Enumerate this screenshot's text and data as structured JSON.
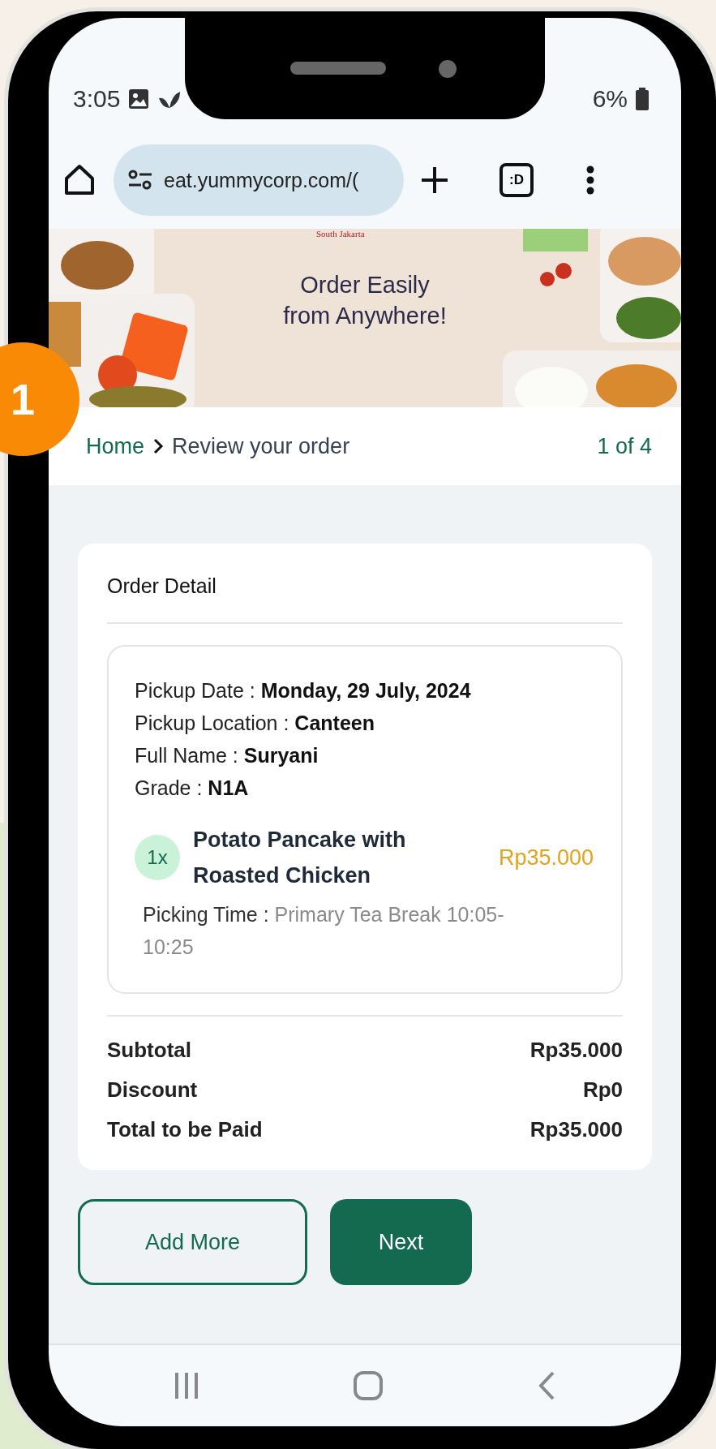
{
  "status_bar": {
    "time": "3:05",
    "battery": "6%"
  },
  "browser": {
    "url": "eat.yummycorp.com/(",
    "tabs": ":D"
  },
  "banner": {
    "brand": "South Jakarta",
    "headline": [
      "Order Easily",
      "from Anywhere!"
    ]
  },
  "step_badge": "1",
  "breadcrumb": {
    "home": "Home",
    "current": "Review your order",
    "step": "1 of 4"
  },
  "order": {
    "title": "Order Detail",
    "details": [
      "Pickup Date : **Monday, 29 July, 2024**",
      "Pickup Location : **Canteen**",
      "Full Name : **Suryani**",
      "Grade : **N1A**"
    ],
    "items": [
      {
        "quantity": "1x",
        "name": "Potato Pancake with Roasted Chicken",
        "price": "Rp35.000",
        "picking_label": "Picking Time :",
        "picking_value": "Primary Tea Break 10:05-10:25"
      }
    ],
    "totals": [
      {
        "label": "Subtotal",
        "value": "Rp35.000"
      },
      {
        "label": "Discount",
        "value": "Rp0"
      },
      {
        "label": "Total to be Paid",
        "value": "Rp35.000"
      }
    ]
  },
  "buttons": [
    {
      "label": "Add More",
      "kind": "outline"
    },
    {
      "label": "Next",
      "kind": "primary"
    }
  ]
}
